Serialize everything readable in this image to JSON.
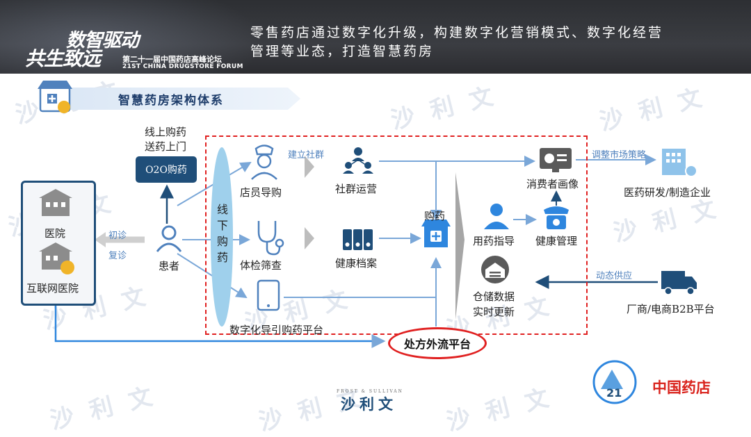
{
  "header": {
    "logo_top": "数智驱动",
    "logo_bottom": "共生致远",
    "forum_cn": "第二十一届中国药店高峰论坛",
    "forum_en": "21ST CHINA DRUGSTORE FORUM",
    "headline_line1": "零售药店通过数字化升级，构建数字化营销模式、数字化经营",
    "headline_line2": "管理等业态，打造智慧药房"
  },
  "section": {
    "title": "智慧药房架构体系"
  },
  "watermark": "沙 利 文",
  "nodes": {
    "online_line1": "线上购药",
    "online_line2": "送药上门",
    "o2o": "O2O购药",
    "hospital": "医院",
    "internet_hospital": "互联网医院",
    "first_visit": "初诊",
    "revisit": "复诊",
    "patient": "患者",
    "offline": "线下购药",
    "staff_guide": "店员导购",
    "checkup": "体检筛查",
    "digital_platform": "数字化导引购药平台",
    "build_community": "建立社群",
    "community_ops": "社群运营",
    "health_records": "健康档案",
    "buy_medicine": "购药",
    "medication_guide": "用药指导",
    "health_mgmt": "健康管理",
    "consumer_profile": "消费者画像",
    "adjust_strategy": "调整市场策略",
    "pharma": "医药研发/制造企业",
    "warehouse_line1": "仓储数据",
    "warehouse_line2": "实时更新",
    "dynamic_supply": "动态供应",
    "vendor": "厂商/电商B2B平台",
    "rx_platform": "处方外流平台"
  },
  "footer": {
    "brand": "沙利文",
    "brand_en": "FROST & SULLIVAN",
    "badge_number": "21",
    "drugstore": "中国药店"
  },
  "colors": {
    "navy": "#1f4e79",
    "accent_blue": "#4f81bd",
    "light_blue": "#9fd0ec",
    "red": "#e02020",
    "gray": "#5a5a5a"
  }
}
